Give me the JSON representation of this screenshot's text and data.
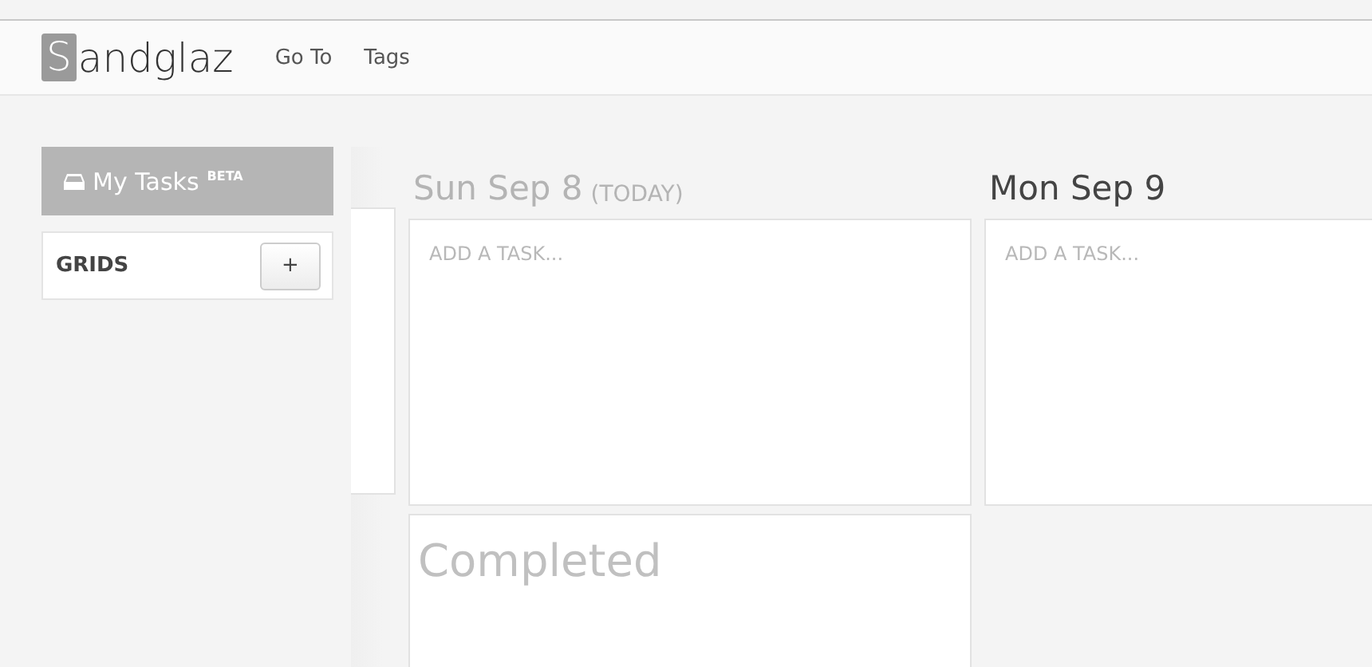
{
  "header": {
    "logo": "Sandglaz",
    "nav": [
      "Go To",
      "Tags"
    ]
  },
  "sidebar": {
    "my_tasks": {
      "label": "My Tasks",
      "badge": "BETA",
      "selected": true
    },
    "grids": {
      "label": "GRIDS",
      "add": "+"
    }
  },
  "days": [
    {
      "title": "Sun Sep 8",
      "note": "(TODAY)",
      "today": true,
      "placeholder": "ADD A TASK...",
      "completed": "Completed"
    },
    {
      "title": "Mon Sep 9",
      "today": false,
      "placeholder": "ADD A TASK..."
    }
  ]
}
